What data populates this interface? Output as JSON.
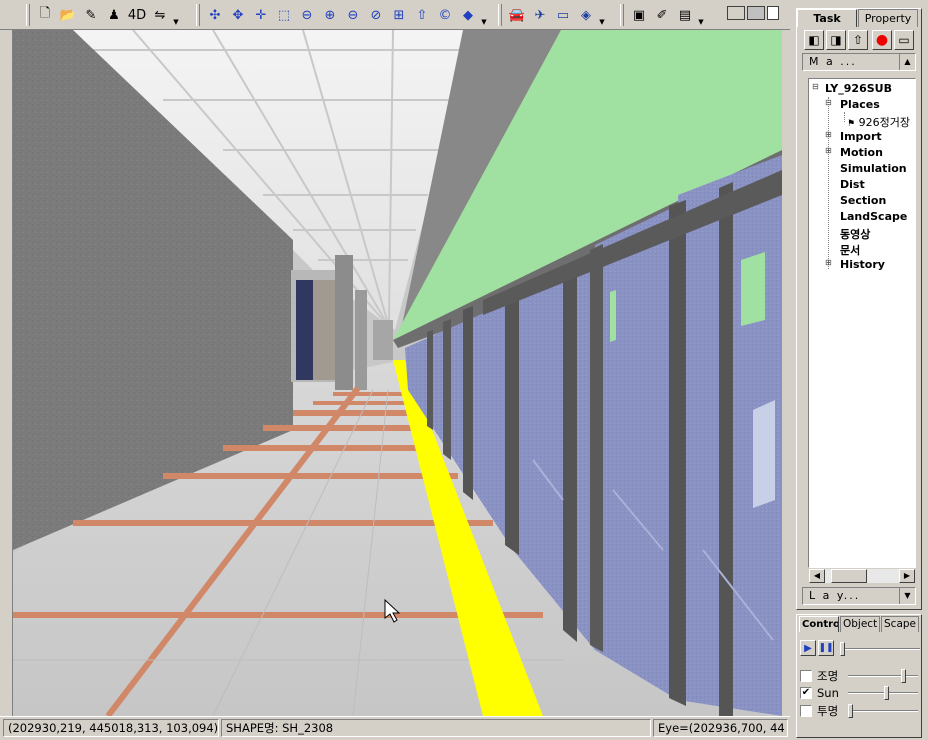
{
  "toolbar": {
    "groups": [
      {
        "items": [
          {
            "name": "new-file-icon",
            "glyph": "🗋"
          },
          {
            "name": "open-folder-icon",
            "glyph": "📂"
          },
          {
            "name": "edit-tool-icon",
            "glyph": "✎"
          },
          {
            "name": "figure-tool-icon",
            "glyph": "♟"
          },
          {
            "name": "four-d-icon",
            "glyph": "4D"
          },
          {
            "name": "route-icon",
            "glyph": "⇋"
          }
        ]
      },
      {
        "items": [
          {
            "name": "orbit-icon",
            "glyph": "✣"
          },
          {
            "name": "rotate-icon",
            "glyph": "✥"
          },
          {
            "name": "pan-icon",
            "glyph": "✛"
          },
          {
            "name": "select-zoom-icon",
            "glyph": "⬚"
          },
          {
            "name": "zoom-icon",
            "glyph": "⊖"
          },
          {
            "name": "zoom-in-icon",
            "glyph": "⊕"
          },
          {
            "name": "zoom-out-icon",
            "glyph": "⊖"
          },
          {
            "name": "zoom-extents-icon",
            "glyph": "⊘"
          },
          {
            "name": "zoom-window-icon",
            "glyph": "⊞"
          },
          {
            "name": "up-icon",
            "glyph": "⇧"
          },
          {
            "name": "refresh-icon",
            "glyph": "©"
          },
          {
            "name": "cube-icon",
            "glyph": "◆"
          }
        ]
      },
      {
        "items": [
          {
            "name": "car-icon",
            "glyph": "🚘"
          },
          {
            "name": "plane-icon",
            "glyph": "✈"
          },
          {
            "name": "measure-icon",
            "glyph": "▭"
          },
          {
            "name": "layer-tool-icon",
            "glyph": "◈"
          }
        ]
      },
      {
        "items": [
          {
            "name": "camera-icon",
            "glyph": "▣"
          },
          {
            "name": "edit-doc-icon",
            "glyph": "✐"
          },
          {
            "name": "document-icon",
            "glyph": "▤"
          }
        ]
      }
    ]
  },
  "status": {
    "coords": "(202930,219, 445018,313, 103,094)",
    "shape": "SHAPE명: SH_2308",
    "eye": "Eye=(202936,700, 44"
  },
  "panel": {
    "tabs": [
      "Task",
      "Property"
    ],
    "top_combo": "M a ...",
    "tree": {
      "root": "LY_926SUB",
      "items": [
        {
          "label": "Places",
          "expander": "-"
        },
        {
          "label": "926정거장",
          "child": true
        },
        {
          "label": "Import",
          "expander": "+"
        },
        {
          "label": "Motion",
          "expander": "+"
        },
        {
          "label": "Simulation"
        },
        {
          "label": "Dist"
        },
        {
          "label": "Section"
        },
        {
          "label": "LandScape"
        },
        {
          "label": "동영상"
        },
        {
          "label": "문서"
        },
        {
          "label": "History",
          "expander": "+"
        }
      ]
    },
    "bottom_combo": "L a y...",
    "bottom_tabs": [
      "Control",
      "Object",
      "Scape"
    ],
    "controls": [
      {
        "label": "조명",
        "checked": false,
        "level": 0.82
      },
      {
        "label": "Sun",
        "checked": true,
        "level": 0.55
      },
      {
        "label": "투명",
        "checked": false,
        "level": 0.0
      }
    ]
  },
  "colors": {
    "ceiling_green": "#a0e0a0",
    "platform_line": "#ffff00",
    "wall": "#7a7a7a",
    "screen_door": "#8890c0"
  }
}
